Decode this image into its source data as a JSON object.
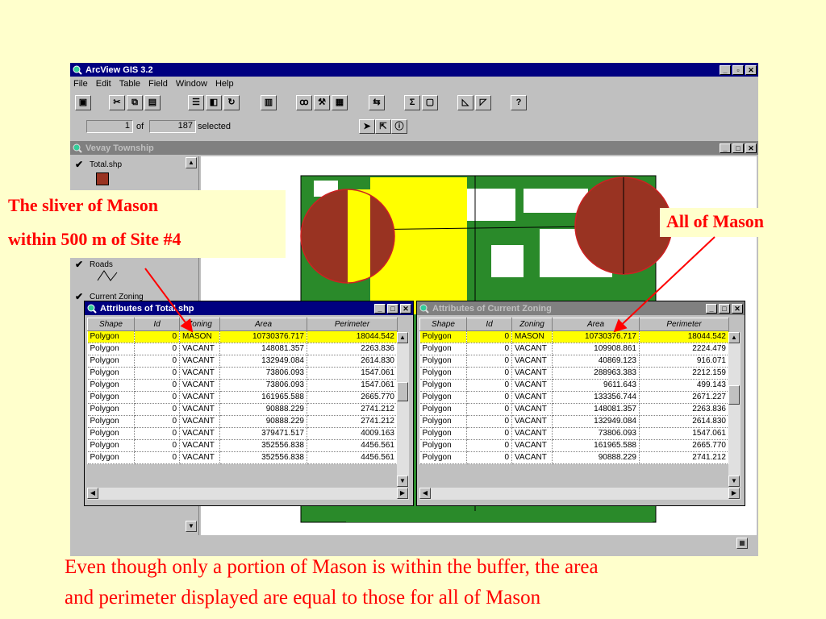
{
  "app": {
    "title": "ArcView GIS 3.2",
    "menu": [
      "File",
      "Edit",
      "Table",
      "Field",
      "Window",
      "Help"
    ],
    "selection": {
      "count": "1",
      "of_label": "of",
      "total": "187",
      "suffix": "selected"
    }
  },
  "view": {
    "title": "Vevay Township",
    "legend": [
      {
        "label": "Total.shp",
        "checked": true
      },
      {
        "label": "Roads",
        "checked": true
      },
      {
        "label": "Current Zoning",
        "checked": true
      }
    ]
  },
  "table_left": {
    "title": "Attributes of Total.shp",
    "columns": [
      "Shape",
      "Id",
      "Zoning",
      "Area",
      "Perimeter"
    ],
    "rows": [
      [
        "Polygon",
        "0",
        "MASON",
        "10730376.717",
        "18044.542"
      ],
      [
        "Polygon",
        "0",
        "VACANT",
        "148081.357",
        "2263.836"
      ],
      [
        "Polygon",
        "0",
        "VACANT",
        "132949.084",
        "2614.830"
      ],
      [
        "Polygon",
        "0",
        "VACANT",
        "73806.093",
        "1547.061"
      ],
      [
        "Polygon",
        "0",
        "VACANT",
        "73806.093",
        "1547.061"
      ],
      [
        "Polygon",
        "0",
        "VACANT",
        "161965.588",
        "2665.770"
      ],
      [
        "Polygon",
        "0",
        "VACANT",
        "90888.229",
        "2741.212"
      ],
      [
        "Polygon",
        "0",
        "VACANT",
        "90888.229",
        "2741.212"
      ],
      [
        "Polygon",
        "0",
        "VACANT",
        "379471.517",
        "4009.163"
      ],
      [
        "Polygon",
        "0",
        "VACANT",
        "352556.838",
        "4456.561"
      ],
      [
        "Polygon",
        "0",
        "VACANT",
        "352556.838",
        "4456.561"
      ]
    ]
  },
  "table_right": {
    "title": "Attributes of Current Zoning",
    "columns": [
      "Shape",
      "Id",
      "Zoning",
      "Area",
      "Perimeter"
    ],
    "rows": [
      [
        "Polygon",
        "0",
        "MASON",
        "10730376.717",
        "18044.542"
      ],
      [
        "Polygon",
        "0",
        "VACANT",
        "109908.861",
        "2224.479"
      ],
      [
        "Polygon",
        "0",
        "VACANT",
        "40869.123",
        "916.071"
      ],
      [
        "Polygon",
        "0",
        "VACANT",
        "288963.383",
        "2212.159"
      ],
      [
        "Polygon",
        "0",
        "VACANT",
        "9611.643",
        "499.143"
      ],
      [
        "Polygon",
        "0",
        "VACANT",
        "133356.744",
        "2671.227"
      ],
      [
        "Polygon",
        "0",
        "VACANT",
        "148081.357",
        "2263.836"
      ],
      [
        "Polygon",
        "0",
        "VACANT",
        "132949.084",
        "2614.830"
      ],
      [
        "Polygon",
        "0",
        "VACANT",
        "73806.093",
        "1547.061"
      ],
      [
        "Polygon",
        "0",
        "VACANT",
        "161965.588",
        "2665.770"
      ],
      [
        "Polygon",
        "0",
        "VACANT",
        "90888.229",
        "2741.212"
      ]
    ]
  },
  "annotations": {
    "left_line1": "The sliver of Mason",
    "left_line2": "within 500 m of Site #4",
    "right": "All of Mason",
    "caption_line1": "Even though only a portion of Mason is within the buffer, the area",
    "caption_line2": "and perimeter displayed are equal to those for all of Mason"
  },
  "colors": {
    "highlight": "#ffff00",
    "mason": "#993322",
    "zoning_green": "#228822",
    "annot_red": "#ff0000",
    "title_active": "#000080"
  }
}
